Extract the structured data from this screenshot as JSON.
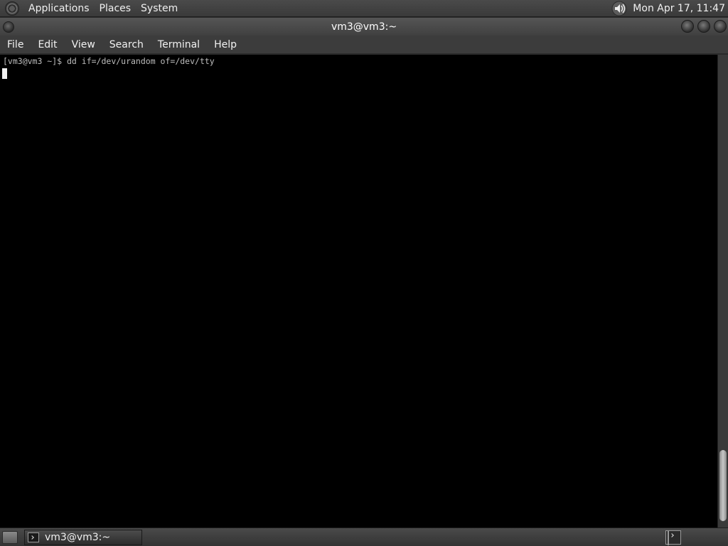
{
  "top_panel": {
    "menus": [
      "Applications",
      "Places",
      "System"
    ],
    "clock": "Mon Apr 17, 11:47",
    "icons": {
      "distro_logo": "distro-logo-icon",
      "volume": "volume-icon"
    }
  },
  "window": {
    "title": "vm3@vm3:~"
  },
  "menubar": {
    "items": [
      "File",
      "Edit",
      "View",
      "Search",
      "Terminal",
      "Help"
    ]
  },
  "terminal": {
    "prompt_line": "[vm3@vm3 ~]$ dd if=/dev/urandom of=/dev/tty"
  },
  "taskbar": {
    "task_label": "vm3@vm3:~",
    "icons": {
      "show_desktop": "show-desktop-icon",
      "task": "terminal-icon",
      "workspace": "workspace-switcher-icon"
    }
  },
  "colors": {
    "terminal_bg": "#000000",
    "terminal_fg": "#bdbdbd",
    "panel_bg": "#3a3a3a"
  }
}
